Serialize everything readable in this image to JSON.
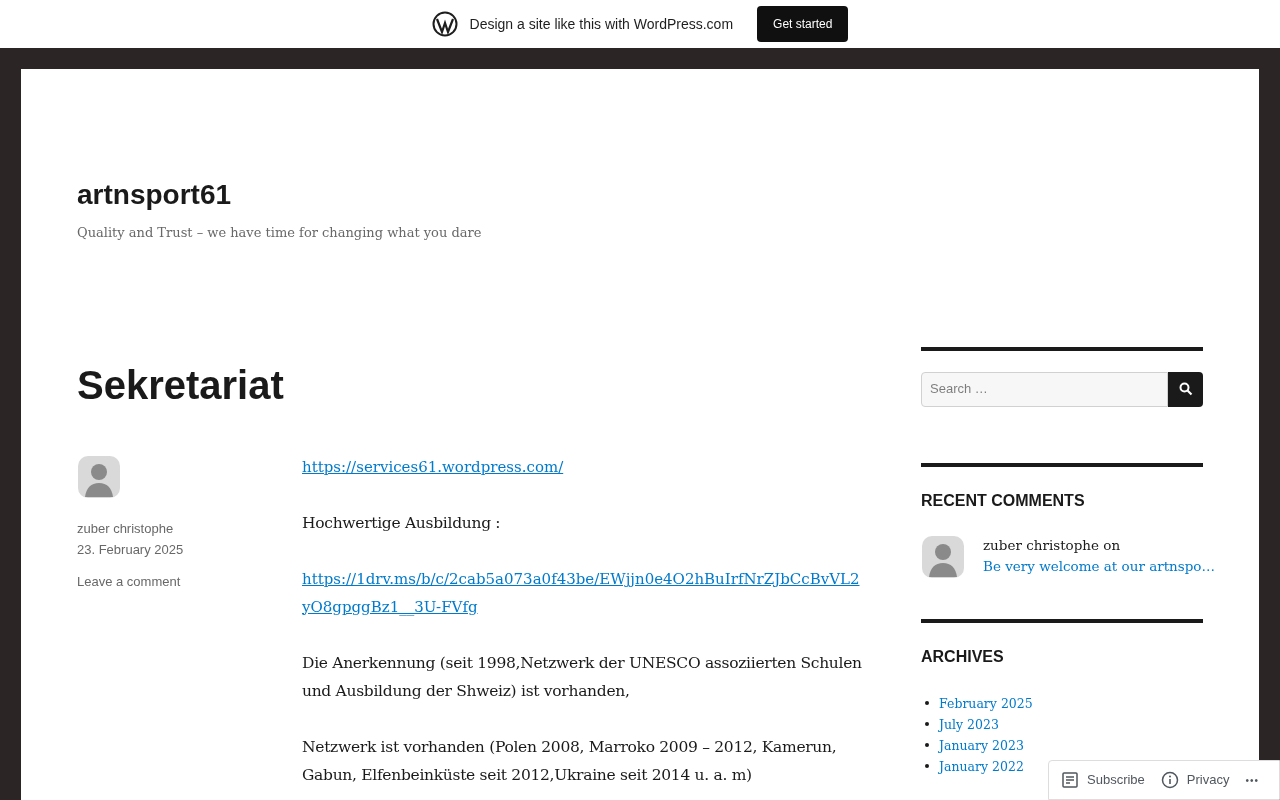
{
  "banner": {
    "text": "Design a site like this with WordPress.com",
    "button": "Get started"
  },
  "site": {
    "title": "artnsport61",
    "tagline": "Quality and Trust – we have time for changing what you dare"
  },
  "post": {
    "title": "Sekretariat",
    "author": "zuber christophe",
    "date": "23. February 2025",
    "comment_link": "Leave a comment",
    "blocks": [
      {
        "kind": "link",
        "text": "https://services61.wordpress.com/"
      },
      {
        "kind": "text",
        "text": "Hochwertige Ausbildung :"
      },
      {
        "kind": "link",
        "text": "https://1drv.ms/b/c/2cab5a073a0f43be/EWjjn0e4O2hBuIrfNrZJbCcBvVL2yO8gpggBz1__3U-FVfg"
      },
      {
        "kind": "text",
        "text": "Die Anerkennung (seit 1998,Netzwerk der UNESCO assoziierten Schulen und Ausbildung der Shweiz) ist vorhanden,"
      },
      {
        "kind": "text",
        "text": "Netzwerk ist vorhanden (Polen 2008, Marroko 2009 – 2012, Kamerun, Gabun, Elfenbeinküste seit 2012,Ukraine seit 2014 u. a. m)"
      }
    ]
  },
  "sidebar": {
    "search": {
      "placeholder": "Search …"
    },
    "recent_comments": {
      "title": "RECENT COMMENTS",
      "items": [
        {
          "author": "zuber christophe",
          "joiner": "on",
          "link": "Be very welcome at our artnspo…"
        }
      ]
    },
    "archives": {
      "title": "ARCHIVES",
      "items": [
        "February 2025",
        "July 2023",
        "January 2023",
        "January 2022"
      ]
    }
  },
  "action_bar": {
    "subscribe": "Subscribe",
    "privacy": "Privacy",
    "more": "•••"
  }
}
